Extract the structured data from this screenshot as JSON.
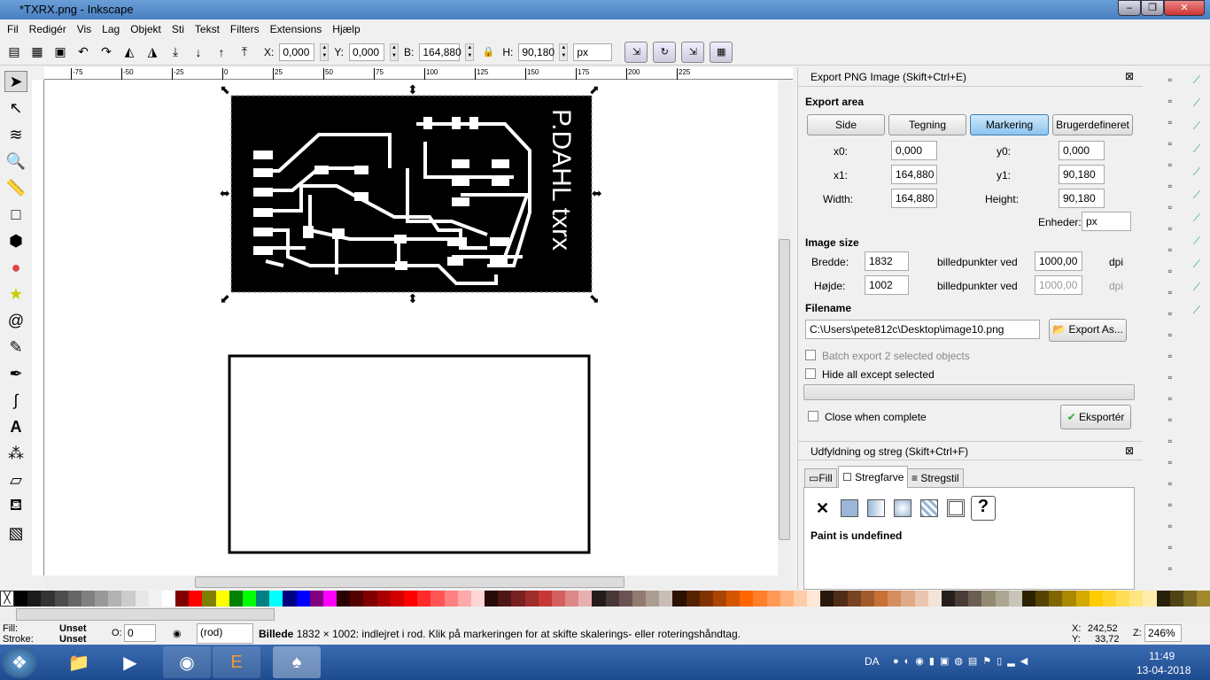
{
  "window": {
    "title": "*TXRX.png - Inkscape"
  },
  "menu": [
    "Fil",
    "Redigér",
    "Vis",
    "Lag",
    "Objekt",
    "Sti",
    "Tekst",
    "Filters",
    "Extensions",
    "Hjælp"
  ],
  "toolbar": {
    "x_label": "X:",
    "x": "0,000",
    "y_label": "Y:",
    "y": "0,000",
    "w_label": "B:",
    "w": "164,880",
    "h_label": "H:",
    "h": "90,180",
    "unit": "px"
  },
  "ruler_ticks": [
    "-75",
    "-50",
    "-25",
    "0",
    "25",
    "50",
    "75",
    "100",
    "125",
    "150",
    "175",
    "200",
    "225"
  ],
  "canvas": {
    "pcb_text": "P.DAHL txrx"
  },
  "export": {
    "title": "Export PNG Image (Skift+Ctrl+E)",
    "area_label": "Export area",
    "tabs": [
      "Side",
      "Tegning",
      "Markering",
      "Brugerdefineret"
    ],
    "active_tab": "Markering",
    "x0_label": "x0:",
    "x0": "0,000",
    "y0_label": "y0:",
    "y0": "0,000",
    "x1_label": "x1:",
    "x1": "164,880",
    "y1_label": "y1:",
    "y1": "90,180",
    "width_label": "Width:",
    "width": "164,880",
    "height_label": "Height:",
    "height": "90,180",
    "units_label": "Enheder:",
    "units": "px",
    "image_size_label": "Image size",
    "bredde_label": "Bredde:",
    "bredde": "1832",
    "hojde_label": "Højde:",
    "hojde": "1002",
    "dpi_text": "billedpunkter ved",
    "dpi1": "1000,00",
    "dpi2": "1000,00",
    "dpi_unit": "dpi",
    "filename_label": "Filename",
    "filename": "C:\\Users\\pete812c\\Desktop\\image10.png",
    "export_as": "Export As...",
    "batch": "Batch export 2 selected objects",
    "hide_all": "Hide all except selected",
    "close_when": "Close when complete",
    "export_btn": "Eksportér"
  },
  "fill": {
    "title": "Udfyldning og streg (Skift+Ctrl+F)",
    "tabs": [
      "Fill",
      "Stregfarve",
      "Stregstil"
    ],
    "active_tab": "Stregfarve",
    "message": "Paint is undefined"
  },
  "palette": [
    "#000000",
    "#1a1a1a",
    "#333333",
    "#4d4d4d",
    "#666666",
    "#808080",
    "#999999",
    "#b3b3b3",
    "#cccccc",
    "#e6e6e6",
    "#f2f2f2",
    "#ffffff",
    "#800000",
    "#ff0000",
    "#808000",
    "#ffff00",
    "#008000",
    "#00ff00",
    "#008080",
    "#00ffff",
    "#000080",
    "#0000ff",
    "#800080",
    "#ff00ff",
    "#2b0000",
    "#550000",
    "#800000",
    "#aa0000",
    "#d40000",
    "#ff0000",
    "#ff2a2a",
    "#ff5555",
    "#ff8080",
    "#ffaaaa",
    "#ffd5d5",
    "#280b0b",
    "#501616",
    "#782121",
    "#a02c2c",
    "#c83737",
    "#d35f5f",
    "#de8787",
    "#e9afaf",
    "#241c1c",
    "#483737",
    "#6c5353",
    "#917c6f",
    "#ac9d93",
    "#c8beb7",
    "#2b1100",
    "#552200",
    "#803300",
    "#aa4400",
    "#d45500",
    "#ff6600",
    "#ff7f2a",
    "#ff9955",
    "#ffb380",
    "#ffccaa",
    "#ffe6d5",
    "#28170b",
    "#502d16",
    "#784421",
    "#a05a2c",
    "#c87137",
    "#d38d5f",
    "#deaa87",
    "#e9c6af",
    "#f4e3d7",
    "#241f1c",
    "#483e37",
    "#6c5d53",
    "#918a6f",
    "#aca793",
    "#c8c4b7",
    "#2b2200",
    "#554400",
    "#806600",
    "#aa8800",
    "#d4aa00",
    "#ffcc00",
    "#ffd42a",
    "#ffdd55",
    "#ffe680",
    "#ffeeaa",
    "#28220b",
    "#504416",
    "#786721",
    "#a0892c"
  ],
  "status": {
    "fill_label": "Fill:",
    "fill_value": "Unset",
    "stroke_label": "Stroke:",
    "stroke_value": "Unset",
    "opacity_label": "O:",
    "opacity": "0",
    "layer": "(rod)",
    "message_bold": "Billede",
    "message": " 1832 × 1002: indlejret i rod. Klik på markeringen for at skifte skalerings- eller roteringshåndtag.",
    "x_label": "X:",
    "x": "242,52",
    "y_label": "Y:",
    "y": "33,72",
    "zoom_label": "Z:",
    "zoom": "246%"
  },
  "taskbar": {
    "lang": "DA",
    "time": "11:49",
    "date": "13-04-2018"
  }
}
